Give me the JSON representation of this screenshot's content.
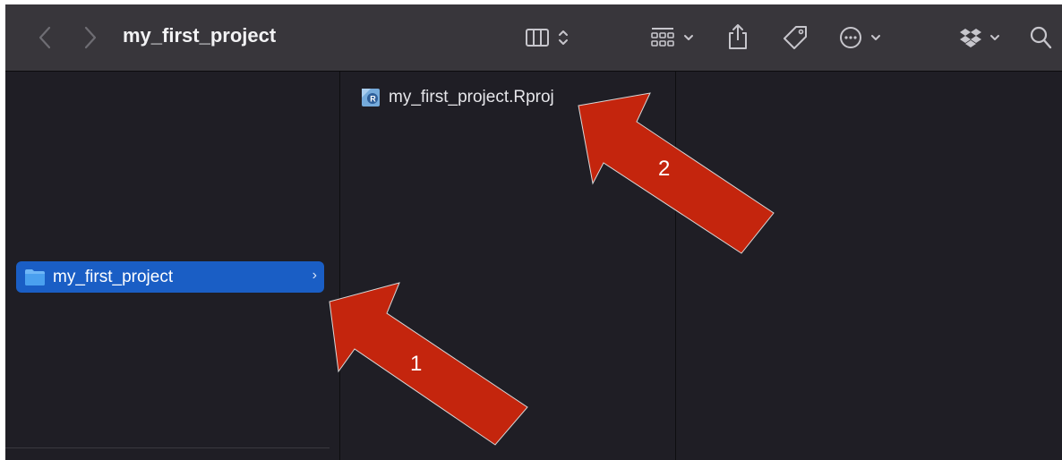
{
  "window": {
    "title": "my_first_project"
  },
  "toolbar": {
    "back_icon": "chevron-left-icon",
    "forward_icon": "chevron-right-icon",
    "view_icon": "column-view-icon",
    "group_icon": "group-grid-icon",
    "share_icon": "share-icon",
    "tag_icon": "tag-icon",
    "more_icon": "ellipsis-circle-icon",
    "dropbox_icon": "dropbox-icon",
    "search_icon": "search-icon"
  },
  "columns": {
    "col1": {
      "items": [
        {
          "label": "my_first_project",
          "icon": "folder-icon",
          "selected": true
        }
      ]
    },
    "col2": {
      "items": [
        {
          "label": "my_first_project.Rproj",
          "icon": "rproj-file-icon"
        }
      ]
    }
  },
  "annotations": [
    {
      "label": "1",
      "color": "#c4250d"
    },
    {
      "label": "2",
      "color": "#c4250d"
    }
  ],
  "colors": {
    "accent": "#1a5ec5",
    "toolbar": "#38363b",
    "background": "#1f1e25",
    "arrow": "#c4250d"
  }
}
